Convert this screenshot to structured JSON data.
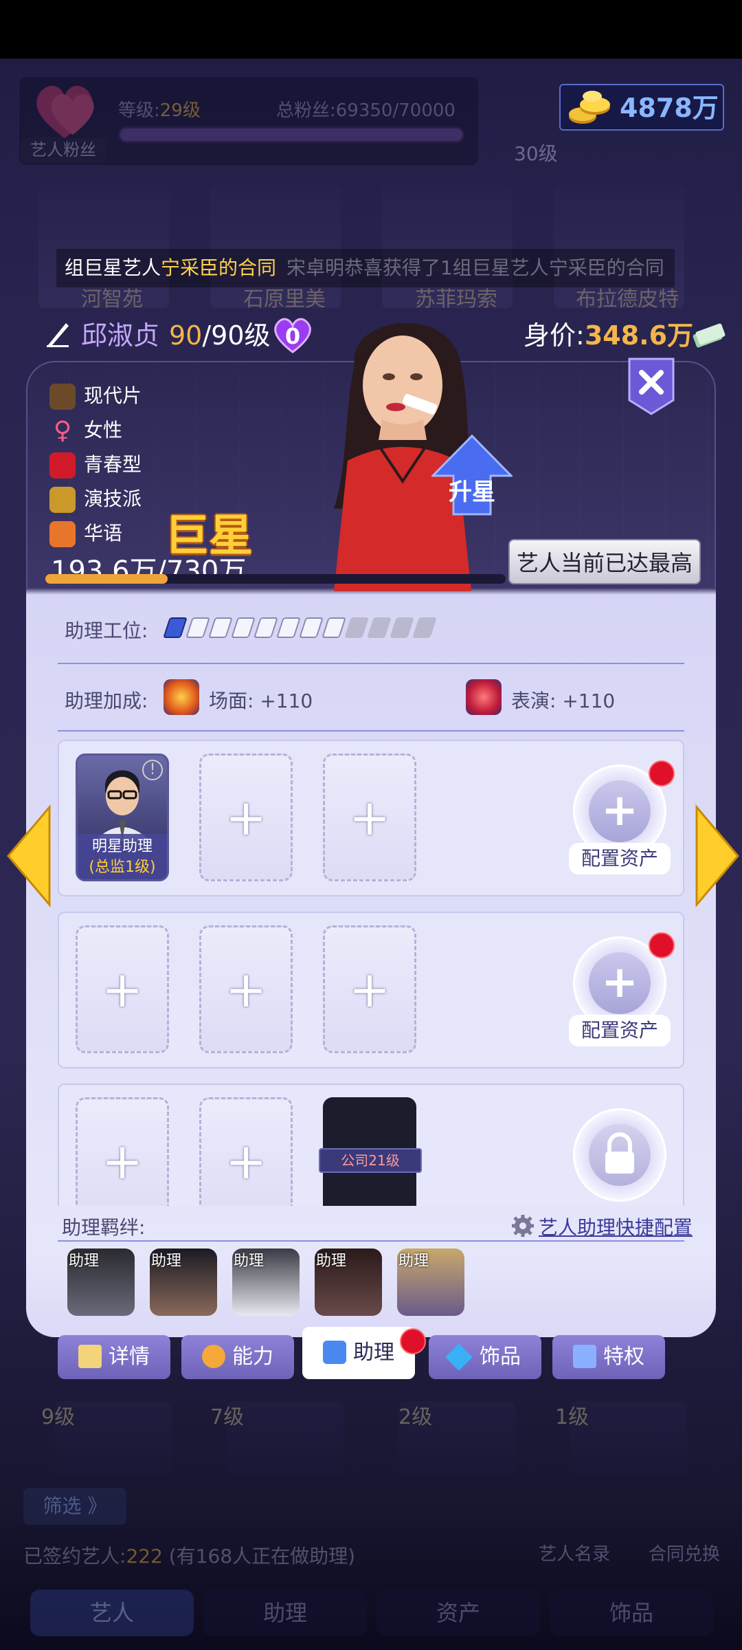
{
  "header": {
    "fan_badge": "艺人粉丝",
    "level_label": "等级:",
    "level_value": "29级",
    "fans_text": "总粉丝:69350/70000",
    "gold": "4878万",
    "company_level": "30级"
  },
  "background_artists": [
    "河智苑",
    "石原里美",
    "苏菲玛索",
    "布拉德皮特"
  ],
  "ticker": {
    "prefix": "组巨星艺人",
    "highlight": "宁采臣的合同",
    "tail": "宋卓明恭喜获得了1组巨星艺人宁采臣的合同"
  },
  "artist": {
    "name": "邱淑贞",
    "level_current": "90",
    "level_max": "/90级",
    "hearts": "0",
    "price_label": "身价:",
    "price_value": "348.6万",
    "tags": [
      {
        "label": "现代片",
        "icon": "film-camera-icon"
      },
      {
        "label": "女性",
        "icon": "female-icon"
      },
      {
        "label": "青春型",
        "icon": "lips-icon"
      },
      {
        "label": "演技派",
        "icon": "trophy-icon"
      },
      {
        "label": "华语",
        "icon": "chinese-language-icon"
      }
    ],
    "rank": "巨星",
    "exp": "193.6万/730万",
    "exp_fraction": 0.265,
    "upgrade_label": "升星",
    "max_notice": "艺人当前已达最高"
  },
  "assistant": {
    "slots_label": "助理工位:",
    "slots_filled": 8,
    "slots_total": 12,
    "bonus_label": "助理加成:",
    "bonus": [
      {
        "name": "场面:",
        "value": "+110",
        "icon": "explosion-icon"
      },
      {
        "name": "表演:",
        "value": "+110",
        "icon": "drama-mask-icon"
      }
    ],
    "config_label": "配置资产",
    "filled_card": {
      "title": "明星助理",
      "subtitle": "(总监1级)"
    },
    "locked_card": "公司21级",
    "plus": "+",
    "bond_label": "助理羁绊:",
    "quick_config": "艺人助理快捷配置",
    "bond_tag": "助理"
  },
  "tabs": [
    "详情",
    "能力",
    "助理",
    "饰品",
    "特权"
  ],
  "bottom": {
    "levels": [
      "9级",
      "7级",
      "2级",
      "1级"
    ],
    "filter": "筛选 》",
    "signed_label": "已签约艺人:",
    "signed_count": "222",
    "signed_note": "(有168人正在做助理)",
    "roster": "艺人名录",
    "exchange": "合同兑换",
    "nav": [
      "艺人",
      "助理",
      "资产",
      "饰品"
    ]
  }
}
